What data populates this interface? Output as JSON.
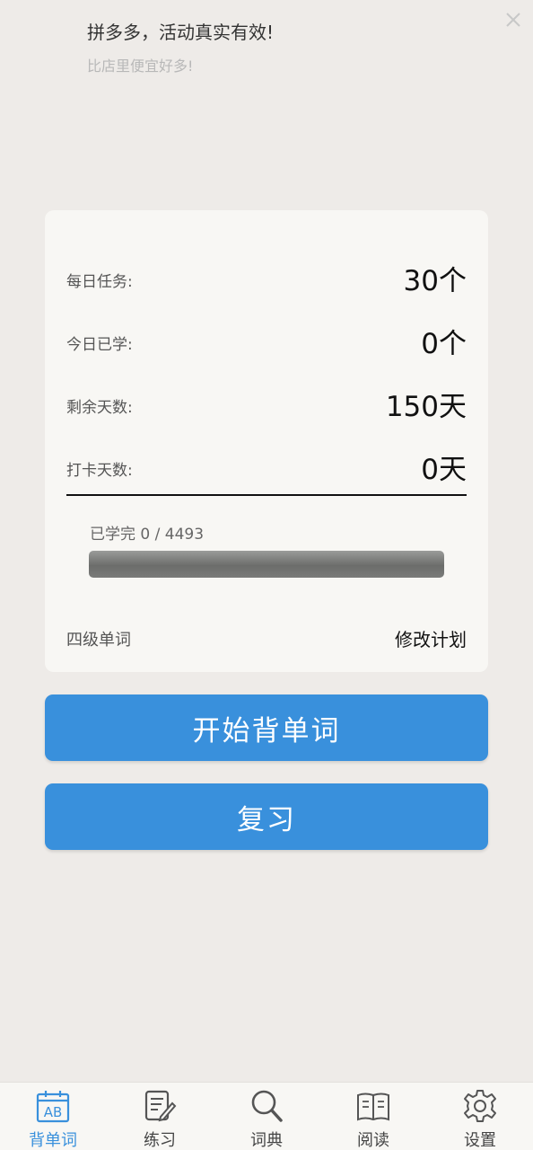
{
  "ad": {
    "title": "拼多多，活动真实有效!",
    "subtitle": "比店里便宜好多!",
    "close_icon": "close-icon"
  },
  "stats": [
    {
      "label": "每日任务:",
      "value": "30个"
    },
    {
      "label": "今日已学:",
      "value": "0个"
    },
    {
      "label": "剩余天数:",
      "value": "150天"
    },
    {
      "label": "打卡天数:",
      "value": "0天"
    }
  ],
  "progress": {
    "text": "已学完 0 / 4493",
    "learned": 0,
    "total": 4493
  },
  "plan": {
    "name": "四级单词",
    "edit_label": "修改计划"
  },
  "buttons": {
    "start": "开始背单词",
    "review": "复习"
  },
  "tabs": [
    {
      "label": "背单词",
      "icon": "calendar-ab-icon",
      "active": true
    },
    {
      "label": "练习",
      "icon": "edit-note-icon",
      "active": false
    },
    {
      "label": "词典",
      "icon": "search-icon",
      "active": false
    },
    {
      "label": "阅读",
      "icon": "book-icon",
      "active": false
    },
    {
      "label": "设置",
      "icon": "gear-icon",
      "active": false
    }
  ],
  "colors": {
    "accent": "#3990dc",
    "background": "#eeebe8",
    "card": "#f8f7f4"
  }
}
